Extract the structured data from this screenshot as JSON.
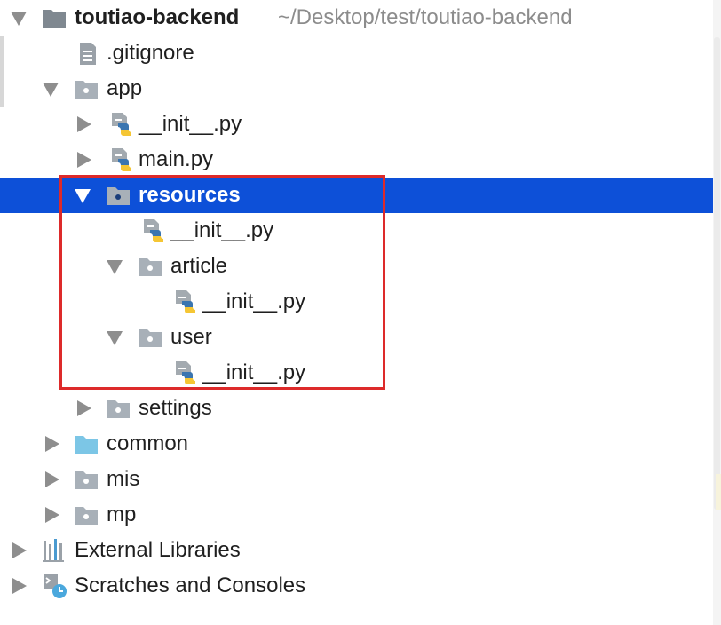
{
  "project": {
    "name": "toutiao-backend",
    "path": "~/Desktop/test/toutiao-backend"
  },
  "files": {
    "gitignore": ".gitignore",
    "app": "app",
    "app_init": "__init__.py",
    "main": "main.py",
    "resources": "resources",
    "resources_init": "__init__.py",
    "article": "article",
    "article_init": "__init__.py",
    "user": "user",
    "user_init": "__init__.py",
    "settings": "settings",
    "common": "common",
    "mis": "mis",
    "mp": "mp"
  },
  "roots": {
    "external_libraries": "External Libraries",
    "scratches": "Scratches and Consoles"
  },
  "icons": {
    "folder": "folder-icon",
    "python_file": "python-file-icon",
    "text_file": "text-file-icon",
    "libraries": "libraries-icon",
    "scratches": "scratches-icon"
  },
  "colors": {
    "selection": "#0d50d8",
    "highlight_box": "#dd2a2a",
    "folder_gray": "#a8b0b8",
    "folder_blue": "#7cc6e6"
  }
}
